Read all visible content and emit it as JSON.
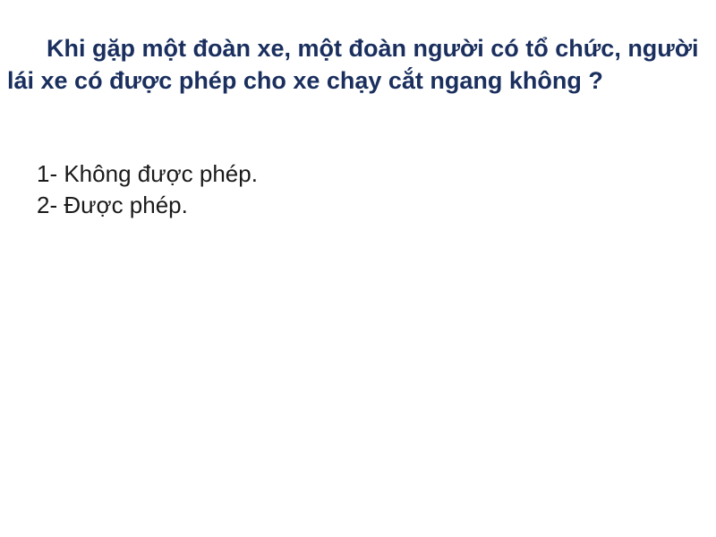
{
  "question": {
    "text": "Khi gặp một đoàn xe, một đoàn người có tổ chức, người lái xe có được phép cho xe chạy cắt ngang không ?"
  },
  "answers": [
    {
      "label": "1- Không được phép."
    },
    {
      "label": "2- Được phép."
    }
  ],
  "colors": {
    "question_text": "#1a2f5e",
    "answer_text": "#1a1a1a",
    "background": "#ffffff"
  }
}
